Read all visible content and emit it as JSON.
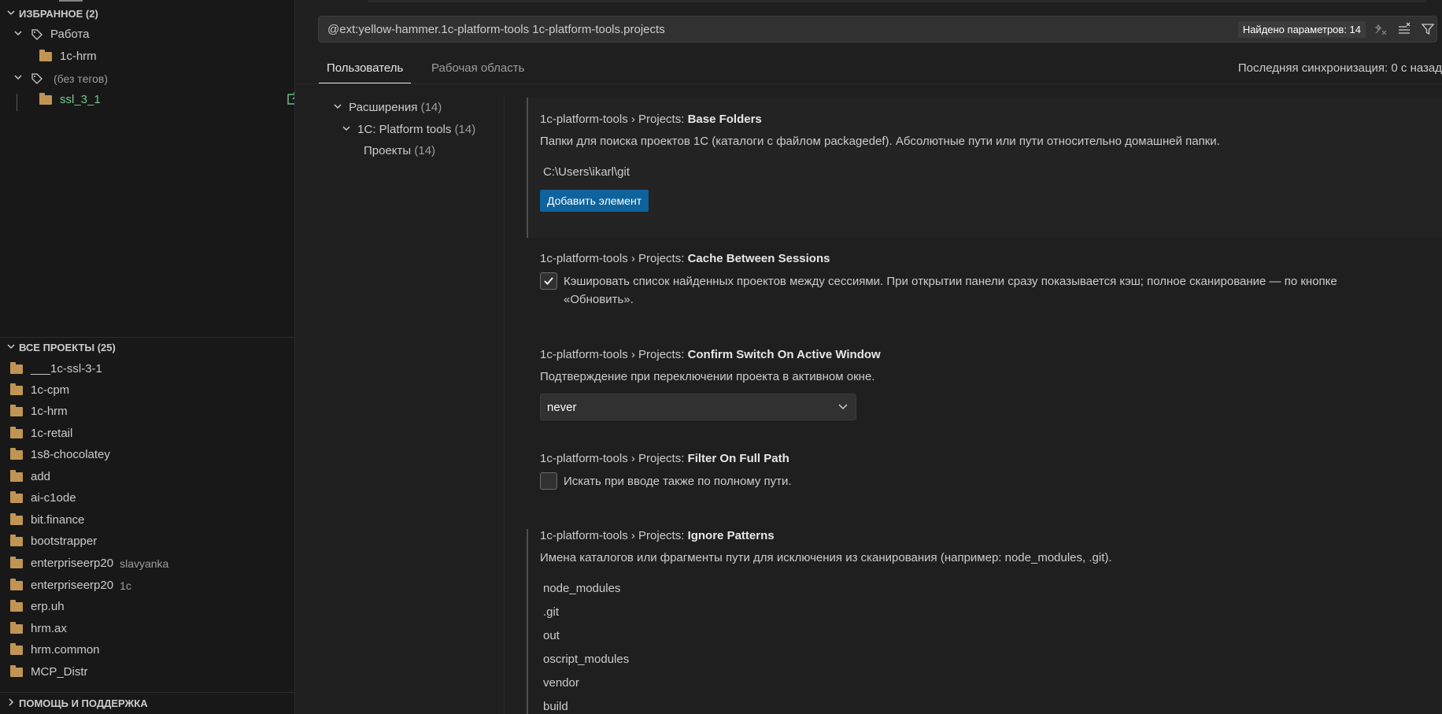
{
  "sidebar": {
    "favorites": {
      "header": "ИЗБРАННОЕ (2)",
      "groups": [
        {
          "tag": "Работа",
          "items": [
            "1c-hrm"
          ]
        },
        {
          "tag": "(без тегов)",
          "items": [
            "ssl_3_1"
          ]
        }
      ]
    },
    "all_projects": {
      "header": "ВСЕ ПРОЕКТЫ (25)",
      "items": [
        {
          "name": "___1c-ssl-3-1",
          "tag": ""
        },
        {
          "name": "1c-cpm",
          "tag": ""
        },
        {
          "name": "1c-hrm",
          "tag": ""
        },
        {
          "name": "1c-retail",
          "tag": ""
        },
        {
          "name": "1s8-chocolatey",
          "tag": ""
        },
        {
          "name": "add",
          "tag": ""
        },
        {
          "name": "ai-c1ode",
          "tag": ""
        },
        {
          "name": "bit.finance",
          "tag": ""
        },
        {
          "name": "bootstrapper",
          "tag": ""
        },
        {
          "name": "enterpriseerp20",
          "tag": "slavyanka"
        },
        {
          "name": "enterpriseerp20",
          "tag": "1c"
        },
        {
          "name": "erp.uh",
          "tag": ""
        },
        {
          "name": "hrm.ax",
          "tag": ""
        },
        {
          "name": "hrm.common",
          "tag": ""
        },
        {
          "name": "MCP_Distr",
          "tag": ""
        }
      ]
    },
    "help": {
      "header": "ПОМОЩЬ И ПОДДЕРЖКА"
    }
  },
  "search": {
    "query": "@ext:yellow-hammer.1c-platform-tools 1c-platform-tools.projects",
    "found": "Найдено параметров: 14"
  },
  "tabs": [
    "Пользователь",
    "Рабочая область"
  ],
  "sync": "Последняя синхронизация: 0 с назад",
  "toc": {
    "extensions": {
      "label": "Расширения",
      "count": "(14)"
    },
    "platform": {
      "label": "1C: Platform tools",
      "count": "(14)"
    },
    "projects": {
      "label": "Проекты",
      "count": "(14)"
    }
  },
  "settings": {
    "base_folders": {
      "prefix": "1c-platform-tools › Projects: ",
      "name": "Base Folders",
      "desc": "Папки для поиска проектов 1С (каталоги с файлом packagedef). Абсолютные пути или пути относительно домашней папки.",
      "items": [
        "C:\\Users\\ikarl\\git"
      ],
      "add_label": "Добавить элемент"
    },
    "cache": {
      "prefix": "1c-platform-tools › Projects: ",
      "name": "Cache Between Sessions",
      "desc_line1": "Кэшировать список найденных проектов между сессиями. При открытии панели сразу показывается кэш; полное сканирование — по кнопке",
      "desc_line2": "«Обновить».",
      "checked": true
    },
    "confirm": {
      "prefix": "1c-platform-tools › Projects: ",
      "name": "Confirm Switch On Active Window",
      "desc": "Подтверждение при переключении проекта в активном окне.",
      "value": "never"
    },
    "filter": {
      "prefix": "1c-platform-tools › Projects: ",
      "name": "Filter On Full Path",
      "desc": "Искать при вводе также по полному пути.",
      "checked": false
    },
    "ignore": {
      "prefix": "1c-platform-tools › Projects: ",
      "name": "Ignore Patterns",
      "desc": "Имена каталогов или фрагменты пути для исключения из сканирования (например: node_modules, .git).",
      "items": [
        "node_modules",
        ".git",
        "out",
        "oscript_modules",
        "vendor",
        "build"
      ]
    }
  },
  "colors": {
    "accent": "#0e639c",
    "folder": "#c09553",
    "git_added": "#73c991"
  }
}
